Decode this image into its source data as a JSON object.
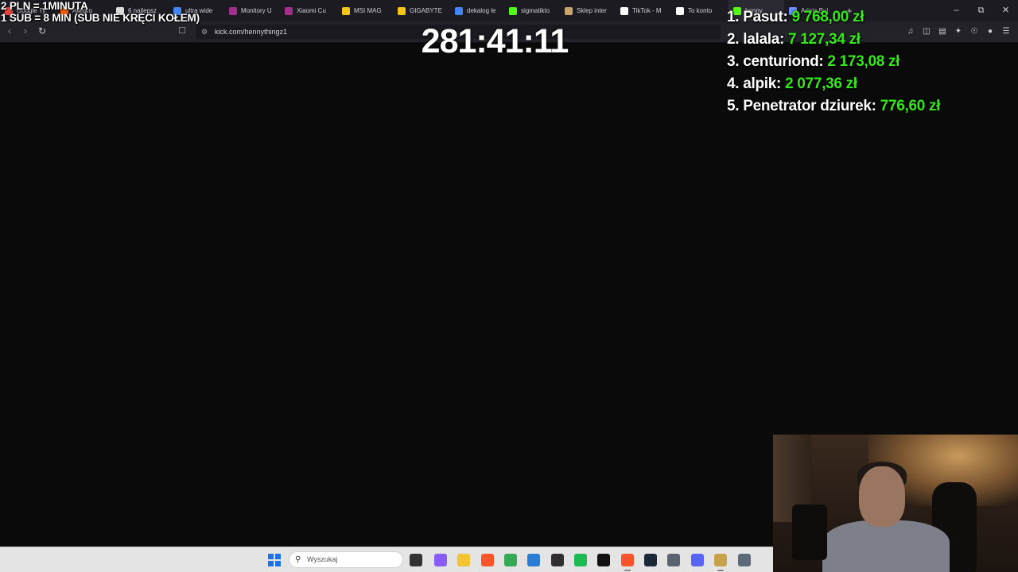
{
  "browser": {
    "tabs": [
      {
        "label": "Google Ty",
        "color": "#e8453c"
      },
      {
        "label": "Allegro",
        "color": "#ff5a00"
      },
      {
        "label": "6 najlepsz",
        "color": "#dddddd"
      },
      {
        "label": "ultra wide",
        "color": "#4285f4"
      },
      {
        "label": "Monitory U",
        "color": "#a0308c"
      },
      {
        "label": "Xiaomi Cu",
        "color": "#a0308c"
      },
      {
        "label": "MSI MAG",
        "color": "#f5c518"
      },
      {
        "label": "GIGABYTE",
        "color": "#f5c518"
      },
      {
        "label": "dekalog le",
        "color": "#4285f4"
      },
      {
        "label": "sigmatikto",
        "color": "#53fc18"
      },
      {
        "label": "Sklep inter",
        "color": "#c8a46a"
      },
      {
        "label": "TikTok - M",
        "color": "#ffffff"
      },
      {
        "label": "To konto",
        "color": "#ffffff"
      },
      {
        "label": "henny",
        "color": "#53fc18"
      },
      {
        "label": "Arinia Bui",
        "color": "#6c8cff"
      }
    ],
    "active_tab_index": 13,
    "new_tab_symbol": "+",
    "url": "kick.com/hennythingz1"
  },
  "overlay": {
    "rate_line1": "2 PLN =  1MINUTA",
    "rate_line2": "1 SUB = 8 MIN (SUB NIE KRĘCI KOŁEM)",
    "timer": "281:41:11",
    "leaderboard": [
      {
        "rank": "1.",
        "name": "Pasut:",
        "amount": "9 768,00 zł"
      },
      {
        "rank": "2.",
        "name": "lalala:",
        "amount": "7 127,34 zł"
      },
      {
        "rank": "3.",
        "name": "centuriond:",
        "amount": "2 173,08 zł"
      },
      {
        "rank": "4.",
        "name": "alpik:",
        "amount": "2 077,36 zł"
      },
      {
        "rank": "5.",
        "name": "Penetrator dziurek:",
        "amount": "776,60 zł"
      }
    ],
    "amount_color": "#35e81a"
  },
  "taskbar": {
    "search_placeholder": "Wyszukaj",
    "apps": [
      {
        "name": "task-view-icon",
        "color": "#333333"
      },
      {
        "name": "copilot-icon",
        "color": "#8a5cf6"
      },
      {
        "name": "file-explorer-icon",
        "color": "#f4c430"
      },
      {
        "name": "brave-icon",
        "color": "#fb542b"
      },
      {
        "name": "chrome-icon",
        "color": "#34a853"
      },
      {
        "name": "store-icon",
        "color": "#2b7cd3"
      },
      {
        "name": "obs-icon",
        "color": "#302e31"
      },
      {
        "name": "spotify-icon",
        "color": "#1db954"
      },
      {
        "name": "media-app-icon",
        "color": "#111111"
      },
      {
        "name": "browser-icon",
        "color": "#fb542b"
      },
      {
        "name": "steam-icon",
        "color": "#1b2838"
      },
      {
        "name": "calculator-icon",
        "color": "#5a6470"
      },
      {
        "name": "discord-icon",
        "color": "#5865f2"
      },
      {
        "name": "game-icon",
        "color": "#c8a24a"
      },
      {
        "name": "settings-icon",
        "color": "#5c6b7a"
      }
    ]
  }
}
